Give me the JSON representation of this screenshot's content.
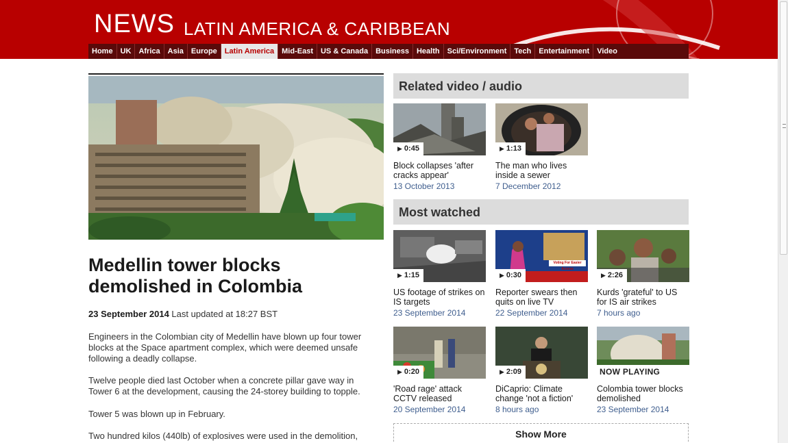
{
  "header": {
    "brand": "NEWS",
    "section": "LATIN AMERICA & CARIBBEAN",
    "nav": [
      {
        "label": "Home"
      },
      {
        "label": "UK"
      },
      {
        "label": "Africa"
      },
      {
        "label": "Asia"
      },
      {
        "label": "Europe"
      },
      {
        "label": "Latin America",
        "active": true
      },
      {
        "label": "Mid-East"
      },
      {
        "label": "US & Canada"
      },
      {
        "label": "Business"
      },
      {
        "label": "Health"
      },
      {
        "label": "Sci/Environment"
      },
      {
        "label": "Tech"
      },
      {
        "label": "Entertainment"
      },
      {
        "label": "Video"
      }
    ]
  },
  "article": {
    "headline": "Medellin tower blocks demolished in Colombia",
    "date": "23 September 2014",
    "updated": "Last updated at 18:27 BST",
    "paragraphs": [
      "Engineers in the Colombian city of Medellin have blown up four tower blocks at the Space apartment complex, which were deemed unsafe following a deadly collapse.",
      "Twelve people died last October when a concrete pillar gave way in Tower 6 at the development, causing the 24-storey building to topple.",
      "Tower 5 was blown up in February.",
      "Two hundred kilos (440lb) of explosives were used in the demolition,"
    ]
  },
  "related": {
    "heading": "Related video / audio",
    "items": [
      {
        "duration": "0:45",
        "title": "Block collapses 'after cracks appear'",
        "date": "13 October 2013"
      },
      {
        "duration": "1:13",
        "title": "The man who lives inside a sewer",
        "date": "7 December 2012"
      }
    ]
  },
  "most_watched": {
    "heading": "Most watched",
    "items": [
      {
        "duration": "1:15",
        "title": "US footage of strikes on IS targets",
        "date": "23 September 2014"
      },
      {
        "duration": "0:30",
        "title": "Reporter swears then quits on live TV",
        "date": "22 September 2014",
        "overlay": "Voting For Easier Access"
      },
      {
        "duration": "2:26",
        "title": "Kurds 'grateful' to US for IS air strikes",
        "date": "7 hours ago"
      },
      {
        "duration": "0:20",
        "title": "'Road rage' attack CCTV released",
        "date": "20 September 2014"
      },
      {
        "duration": "2:09",
        "title": "DiCaprio: Climate change 'not a fiction'",
        "date": "8 hours ago"
      },
      {
        "now_playing": "NOW PLAYING",
        "title": "Colombia tower blocks demolished",
        "date": "23 September 2014"
      }
    ],
    "show_more": "Show More"
  },
  "colors": {
    "brand_red": "#b80000",
    "nav_dark": "#5a0a0a",
    "date_blue": "#3f5e8e",
    "section_grey": "#dcdcdc"
  }
}
